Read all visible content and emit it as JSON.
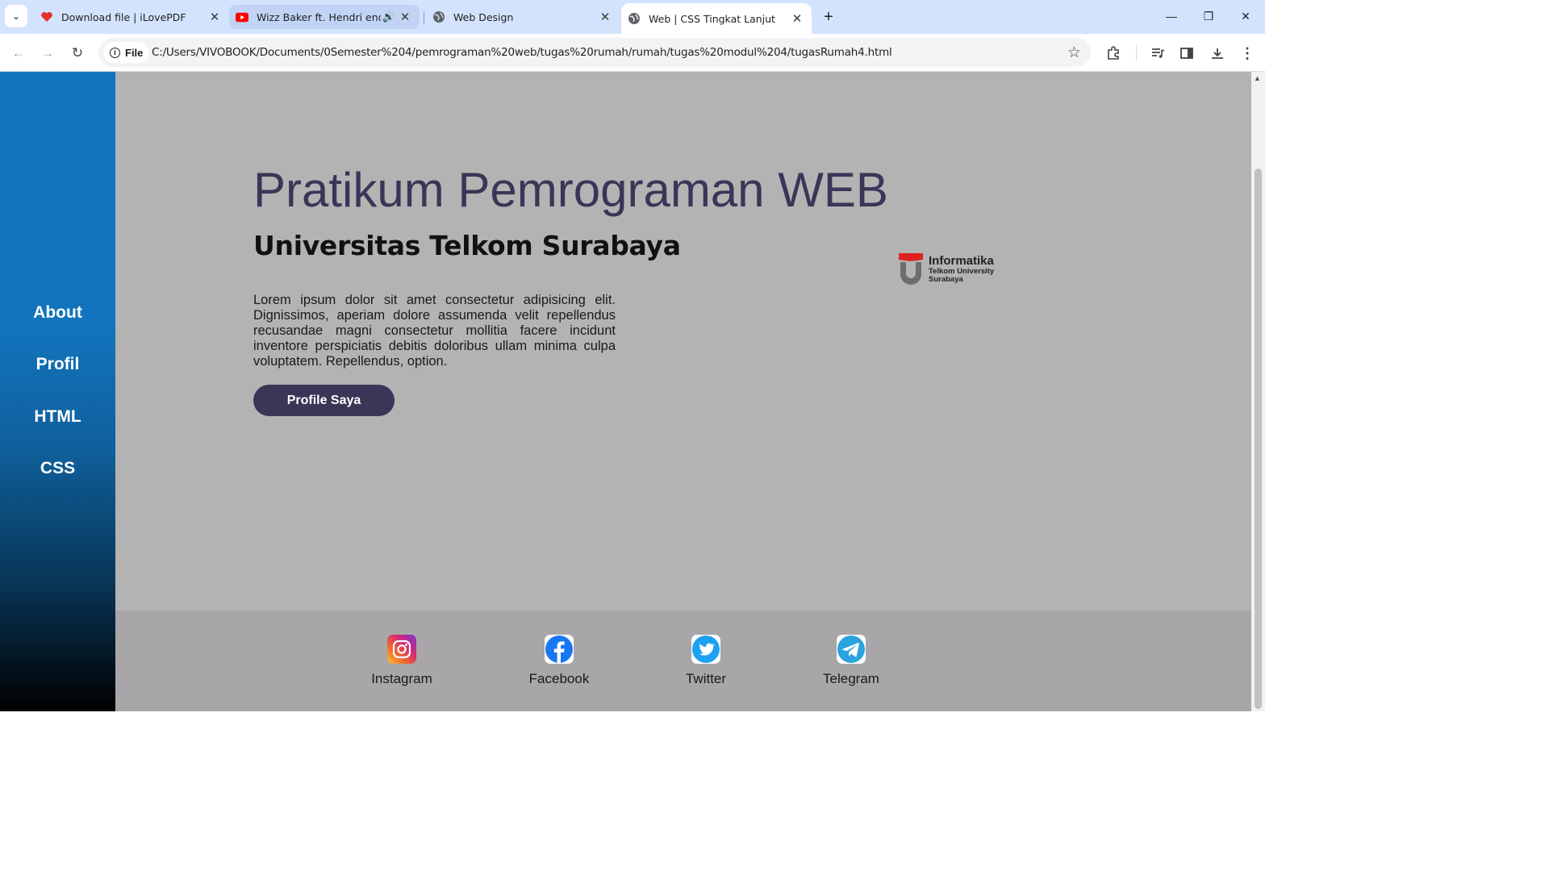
{
  "browser": {
    "tabs": [
      {
        "title": "Download file | iLovePDF",
        "icon": "ilovepdf-heart-icon"
      },
      {
        "title": "Wizz Baker ft. Hendri endico",
        "icon": "youtube-icon",
        "audio": "speaker-icon"
      },
      {
        "title": "Web Design",
        "icon": "globe-icon"
      },
      {
        "title": "Web | CSS Tingkat Lanjut",
        "icon": "globe-icon",
        "active": true
      }
    ],
    "chip_label": "File",
    "url": "C:/Users/VIVOBOOK/Documents/0Semester%204/pemrograman%20web/tugas%20rumah/rumah/tugas%20modul%204/tugasRumah4.html"
  },
  "sidebar": {
    "items": [
      {
        "label": "About"
      },
      {
        "label": "Profil"
      },
      {
        "label": "HTML"
      },
      {
        "label": "CSS"
      }
    ]
  },
  "main": {
    "title": "Pratikum Pemrograman WEB",
    "subtitle": "Universitas Telkom Surabaya",
    "paragraph": "Lorem ipsum dolor sit amet consectetur adipisicing elit. Dignissimos, aperiam dolore assumenda velit repellendus recusandae magni consectetur mollitia facere incidunt inventore perspiciatis debitis doloribus ullam minima culpa voluptatem. Repellendus, option.",
    "button_label": "Profile Saya",
    "logo": {
      "line1": "Informatika",
      "line2": "Telkom University",
      "line3": "Surabaya"
    }
  },
  "footer": {
    "socials": [
      {
        "label": "Instagram",
        "icon": "instagram-icon"
      },
      {
        "label": "Facebook",
        "icon": "facebook-icon"
      },
      {
        "label": "Twitter",
        "icon": "twitter-icon"
      },
      {
        "label": "Telegram",
        "icon": "telegram-icon"
      }
    ]
  },
  "colors": {
    "sidebar_top": "#1274bd",
    "page_bg": "#b3b3b3",
    "footer_bg": "#a8a6a8",
    "title_color": "#3b3558",
    "button_bg": "#3b3558"
  }
}
